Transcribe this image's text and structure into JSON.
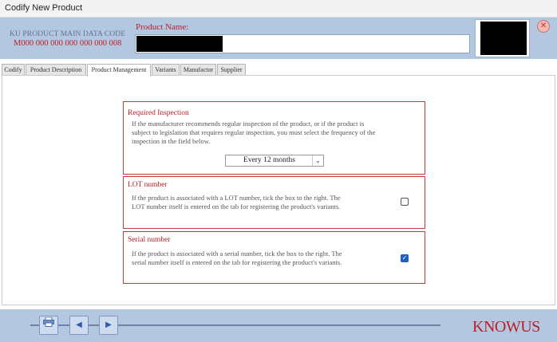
{
  "window": {
    "title": "Codify New Product"
  },
  "header": {
    "code_label": "KU PRODUCT MAIN DATA CODE",
    "code_value": "M000 000 000 000 000 000 008",
    "product_name_label": "Product Name:",
    "close_icon": "close-icon"
  },
  "tabs": [
    {
      "label": "Codify"
    },
    {
      "label": "Product Description"
    },
    {
      "label": "Product Management",
      "active": true
    },
    {
      "label": "Variants"
    },
    {
      "label": "Manufactor"
    },
    {
      "label": "Supplier"
    }
  ],
  "inspection": {
    "title": "Required Inspection",
    "text_lines": [
      "If the manufacturer recommends regular inspection of the product, or if the product is",
      "subject to legislation that requires regular inspection, you must select the frequency of the",
      "inspection in the field below."
    ],
    "frequency": "Every 12 months"
  },
  "lot": {
    "title": "LOT number",
    "text_lines": [
      "If the product is associated with a LOT number, tick the box to the right. The",
      "LOT number itself is entered on the tab for registering the product's variants."
    ],
    "checked": false
  },
  "serial": {
    "title": "Serial number",
    "text_lines": [
      "If the product is associated with a serial number, tick the box to the right. The",
      "serial number itself is entered on the tab for registering the product's variants."
    ],
    "checked": true
  },
  "footer": {
    "logo_text": "KNOWUS",
    "print_icon": "printer-icon",
    "prev_icon": "arrow-left-icon",
    "next_icon": "arrow-right-icon"
  },
  "colors": {
    "header_bg": "#b3c7e0",
    "accent_red": "#b8202a",
    "checkbox_blue": "#1f5ec2"
  }
}
